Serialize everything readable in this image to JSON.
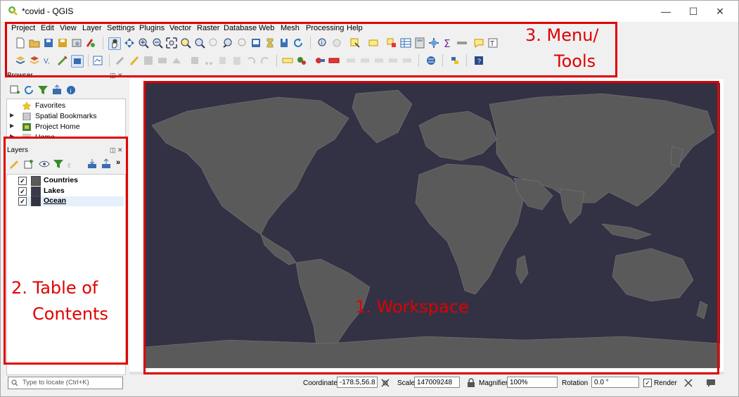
{
  "window": {
    "title": "*covid - QGIS",
    "minimize": "—",
    "maximize": "☐",
    "close": "✕"
  },
  "menu": [
    "Project",
    "Edit",
    "View",
    "Layer",
    "Settings",
    "Plugins",
    "Vector",
    "Raster",
    "Database",
    "Web",
    "Mesh",
    "Processing",
    "Help"
  ],
  "browser": {
    "title": "Browser",
    "items": [
      "Favorites",
      "Spatial Bookmarks",
      "Project Home",
      "Home"
    ]
  },
  "layers": {
    "title": "Layers",
    "more": "»",
    "items": [
      {
        "name": "Countries",
        "swatch": "#5a5a5a",
        "checked": "✓"
      },
      {
        "name": "Lakes",
        "swatch": "#3a3a4e",
        "checked": "✓"
      },
      {
        "name": "Ocean",
        "swatch": "#323244",
        "checked": "✓"
      }
    ]
  },
  "annotations": {
    "workspace": "1. Workspace",
    "toc_line1": "2. Table of",
    "toc_line2": "Contents",
    "menu_line1": "3. Menu/",
    "menu_line2": "Tools"
  },
  "statusbar": {
    "locate_placeholder": "Type to locate (Ctrl+K)",
    "coordinate_label": "Coordinate",
    "coordinate_value": "-178.5,56.8",
    "scale_label": "Scale",
    "scale_value": "147009248",
    "magnifier_label": "Magnifier",
    "magnifier_value": "100%",
    "rotation_label": "Rotation",
    "rotation_value": "0.0 °",
    "render_label": "Render",
    "render_checked": "✓"
  },
  "colors": {
    "annotation": "#e00000",
    "ocean": "#323244",
    "land": "#5a5a5a"
  }
}
